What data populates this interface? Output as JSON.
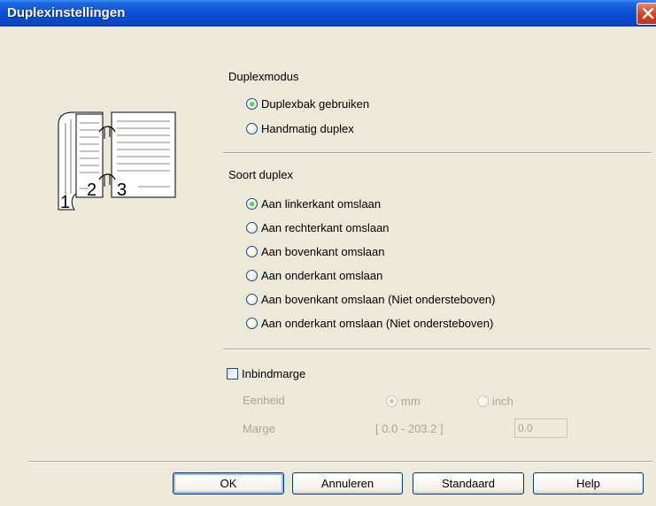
{
  "window": {
    "title": "Duplexinstellingen"
  },
  "duplex_mode": {
    "heading": "Duplexmodus",
    "options": [
      {
        "label": "Duplexbak gebruiken",
        "selected": true
      },
      {
        "label": "Handmatig duplex",
        "selected": false
      }
    ]
  },
  "duplex_type": {
    "heading": "Soort duplex",
    "options": [
      {
        "label": "Aan linkerkant omslaan",
        "selected": true
      },
      {
        "label": "Aan rechterkant omslaan",
        "selected": false
      },
      {
        "label": "Aan bovenkant omslaan",
        "selected": false
      },
      {
        "label": "Aan onderkant omslaan",
        "selected": false
      },
      {
        "label": "Aan bovenkant omslaan (Niet ondersteboven)",
        "selected": false
      },
      {
        "label": "Aan onderkant omslaan (Niet ondersteboven)",
        "selected": false
      }
    ]
  },
  "binding": {
    "checkbox_label": "Inbindmarge",
    "checked": false,
    "unit_label": "Eenheid",
    "unit_options": [
      {
        "label": "mm",
        "selected": true
      },
      {
        "label": "inch",
        "selected": false
      }
    ],
    "margin_label": "Marge",
    "range": "[ 0.0 - 203.2 ]",
    "value": "0.0"
  },
  "illustration": {
    "pages": [
      "1",
      "2",
      "3"
    ]
  },
  "buttons": {
    "ok": "OK",
    "cancel": "Annuleren",
    "default": "Standaard",
    "help": "Help"
  }
}
